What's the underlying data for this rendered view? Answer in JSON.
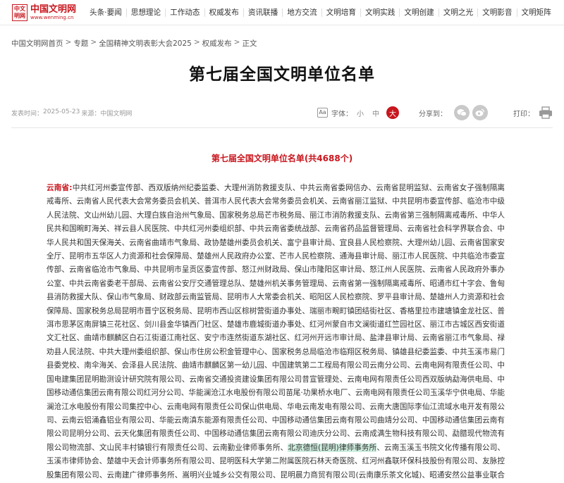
{
  "header": {
    "logo_seal": "中文 明网",
    "logo_name": "中国文明网",
    "logo_url": "www.wenming.cn",
    "nav": [
      "头条·要闻",
      "思想理论",
      "工作动态",
      "权威发布",
      "资讯联播",
      "地方交流",
      "文明培育",
      "文明实践",
      "文明创建",
      "文明之光",
      "文明影音",
      "文明矩阵"
    ]
  },
  "breadcrumb": [
    "中国文明网首页",
    "专题",
    "全国精神文明表彰大会2025",
    "权威发布",
    "正文"
  ],
  "breadcrumb_sep": ">",
  "title": "第七届全国文明单位名单",
  "meta": {
    "publish_label": "发表时间：",
    "publish_date": "2025-05-23",
    "source_label": "来源：",
    "source": "中国文明网",
    "font_label": "字体：",
    "font_icon": "Aa",
    "font_small": "小",
    "font_medium": "中",
    "font_large": "大",
    "share_label": "分享到：",
    "print_label": "打印："
  },
  "icons": {
    "font": "font-size-icon",
    "wechat": "wechat-icon",
    "weibo": "weibo-icon",
    "print": "printer-icon"
  },
  "colors": {
    "accent": "#c8161d",
    "highlight": "#cfeee0"
  },
  "article": {
    "heading": "第七届全国文明单位名单(共4688个)",
    "province": "云南省:",
    "text_before": "中共红河州委宣传部、西双版纳州纪委监委、大理州消防救援支队、中共云南省委网信办、云南省昆明监狱、云南省女子强制隔离戒毒所、云南省人民代表大会常务委员会机关、普洱市人民代表大会常务委员会机关、云南省丽江监狱、中共昆明市委宣传部、临沧市中级人民法院、文山州幼儿园、大理白族自治州气象局、国家税务总局芒市税务局、丽江市消防救援支队、云南省第三强制隔离戒毒所、中华人民共和国畹町海关、祥云县人民医院、中共红河州委组织部、中共云南省委统战部、云南省药品监督管理局、云南省社会科学界联合会、中华人民共和国天保海关、云南省曲靖市气象局、政协楚雄州委员会机关、富宁县审计局、宜良县人民检察院、大理州幼儿园、云南省国家安全厅、昆明市五华区人力资源和社会保障局、楚雄州人民政府办公室、芒市人民检察院、通海县审计局、丽江市人民医院、中共临沧市委宣传部、云南省临沧市气象局、中共昆明市呈贡区委宣传部、怒江州财政局、保山市隆阳区审计局、怒江州人民医院、云南省人民政府外事办公室、中共云南省委老干部局、云南省公安厅交通管理总队、楚雄州机关事务管理局、云南省第一强制隔离戒毒所、昭通市红十字会、鲁甸县消防救援大队、保山市气象局、财政部云南监管局、昆明市人大常委会机关、昭阳区人民检察院、罗平县审计局、楚雄州人力资源和社会保障局、国家税务总局昆明市晋宁区税务局、昆明市西山区棕树营街道办事处、瑞丽市畹町镇团结街社区、香格里拉市建塘镇金龙社区、普洱市思茅区南屏镇三花社区、剑川县金华镇西门社区、楚雄市鹿城街道办事处、红河州蒙自市文澜街道红竺园社区、丽江市古城区西安街道文汇社区、曲靖市麒麟区白石江街道江南社区、安宁市连然街道东湖社区、红河州开远市审计局、盐津县审计局、云南省丽江市气象局、禄劝县人民法院、中共大理州委组织部、保山市住房公积金管理中心、国家税务总局临沧市临翔区税务局、镇雄县纪委监委、中共玉溪市易门县委党校、南伞海关、会泽县人民法院、曲靖市麒麟区第一幼儿园、中国建筑第二工程局有限公司云南分公司、云南电网有限责任公司、中国电建集团昆明勘测设计研究院有限公司、云南省交通投资建设集团有限公司昔宣管理处、云南电网有限责任公司西双版纳勐海供电局、中国移动通信集团云南有限公司红河分公司、华能澜沧江水电股份有限公司苗尾·功果桥水电厂、云南电网有限责任公司玉溪华宁供电局、华能澜沧江水电股份有限公司集控中心、云南电网有限责任公司保山供电局、华电云南发电有限公司、云南大唐国际李仙江流域水电开发有限公司、云南云铝涌鑫铝业有限公司、华能云南滇东能源有限责任公司、中国移动通信集团云南有限公司曲靖分公司、中国移动通信集团云南有限公司昆明分公司、云天化集团有限责任公司、中国移动通信集团云南有限公司迪庆分公司、云南成满生物科技有限公司、勐腊现代物流有限公司物流部、文山民丰村镇银行有限责任公司、云南勤业律师事务所、",
    "highlight": "北京德恒(昆明)律师事务所",
    "text_after": "、云南玉溪玉书院文化传播有限公司、玉溪市律师协会、楚雄中天会计师事务所有限公司、昆明医科大学第二附属医院石林天奇医院、红河州鑫联环保科技股份有限公司、友脉控股集团有限公司、云南建广律师事务所、嵩明兴业城乡公交有限公司、昆明晨力商贸有限公司(云南康乐茶文化城)、昭通安然公益事业联合会、腾冲市高黎贡山生态茶业有限责任公司、曲靖晶澳光伏科技有限公司"
  }
}
